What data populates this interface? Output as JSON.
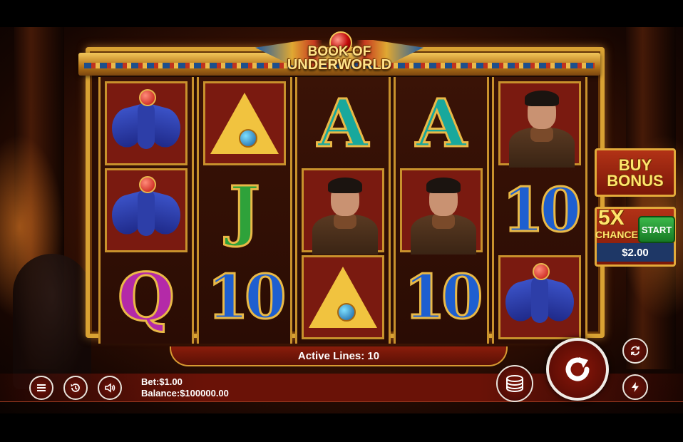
{
  "game": {
    "logo_line1": "BOOK OF",
    "logo_line2": "UNDERWORLD"
  },
  "reels": [
    [
      "scarab-bird",
      "scarab-bird",
      "Q"
    ],
    [
      "pyramid",
      "J",
      "10"
    ],
    [
      "A",
      "explorer",
      "pyramid"
    ],
    [
      "A",
      "explorer",
      "10"
    ],
    [
      "explorer",
      "10",
      "scarab-bird"
    ]
  ],
  "symbols": {
    "A": "A",
    "J": "J",
    "Q": "Q",
    "ten": "10"
  },
  "buy_bonus": {
    "line1": "BUY",
    "line2": "BONUS"
  },
  "chance": {
    "multiplier": "5X",
    "label": "CHANCE",
    "start_label": "START",
    "price": "$2.00"
  },
  "status": {
    "active_lines": "Active Lines: 10",
    "bet_label": "Bet:",
    "bet_value": "$1.00",
    "balance_label": "Balance:",
    "balance_value": "$100000.00"
  },
  "icons": {
    "menu": "menu-icon",
    "history": "history-icon",
    "sound": "speaker-icon",
    "coins": "coins-icon",
    "spin": "spin-arrow-icon",
    "autoplay": "autoplay-icon",
    "turbo": "lightning-icon"
  },
  "colors": {
    "gold": "#d9a233",
    "panel_red": "#7a1708",
    "start_green": "#3bb84a"
  }
}
